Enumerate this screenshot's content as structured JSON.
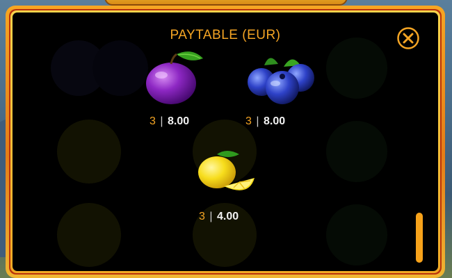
{
  "paytable": {
    "title": "PAYTABLE (EUR)",
    "items": [
      {
        "icon": "plum-icon",
        "count": "3",
        "separator": "|",
        "value": "8.00"
      },
      {
        "icon": "blueberries-icon",
        "count": "3",
        "separator": "|",
        "value": "8.00"
      },
      {
        "icon": "lemon-icon",
        "count": "3",
        "separator": "|",
        "value": "4.00"
      }
    ]
  },
  "colors": {
    "accent": "#f5a524",
    "frame_gold": "#f6a623",
    "panel_bg": "#000000"
  },
  "close_icon": "close-icon"
}
